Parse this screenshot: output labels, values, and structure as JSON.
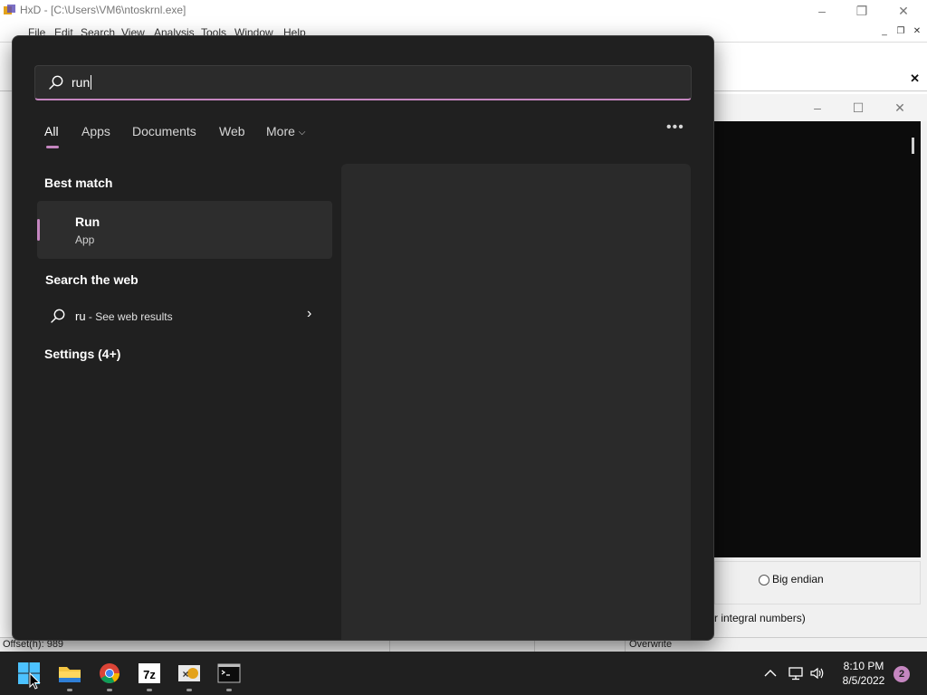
{
  "background_app": {
    "title": "HxD - [C:\\Users\\VM6\\ntoskrnl.exe]",
    "menu": [
      "File",
      "Edit",
      "Search",
      "View",
      "Analysis",
      "Tools",
      "Window",
      "Help"
    ],
    "dialog": {
      "radio_label": "Big endian",
      "note": "r integral numbers)"
    },
    "status": {
      "offset": "Offset(h): 989",
      "mode": "Overwrite"
    }
  },
  "search": {
    "query": "run",
    "tabs": [
      "All",
      "Apps",
      "Documents",
      "Web",
      "More"
    ],
    "best_match": {
      "heading": "Best match",
      "name": "Run",
      "type": "App"
    },
    "web": {
      "heading": "Search the web",
      "query": "ru",
      "suffix": " - See web results"
    },
    "settings": {
      "heading": "Settings (4+)"
    }
  },
  "taskbar": {
    "apps": [
      "windows-start-icon",
      "file-explorer-icon",
      "chrome-icon",
      "7zip-icon",
      "hxd-icon",
      "terminal-icon"
    ],
    "time": "8:10 PM",
    "date": "8/5/2022",
    "notifications": "2"
  },
  "colors": {
    "accent": "#c586c0",
    "panel": "#202020"
  }
}
